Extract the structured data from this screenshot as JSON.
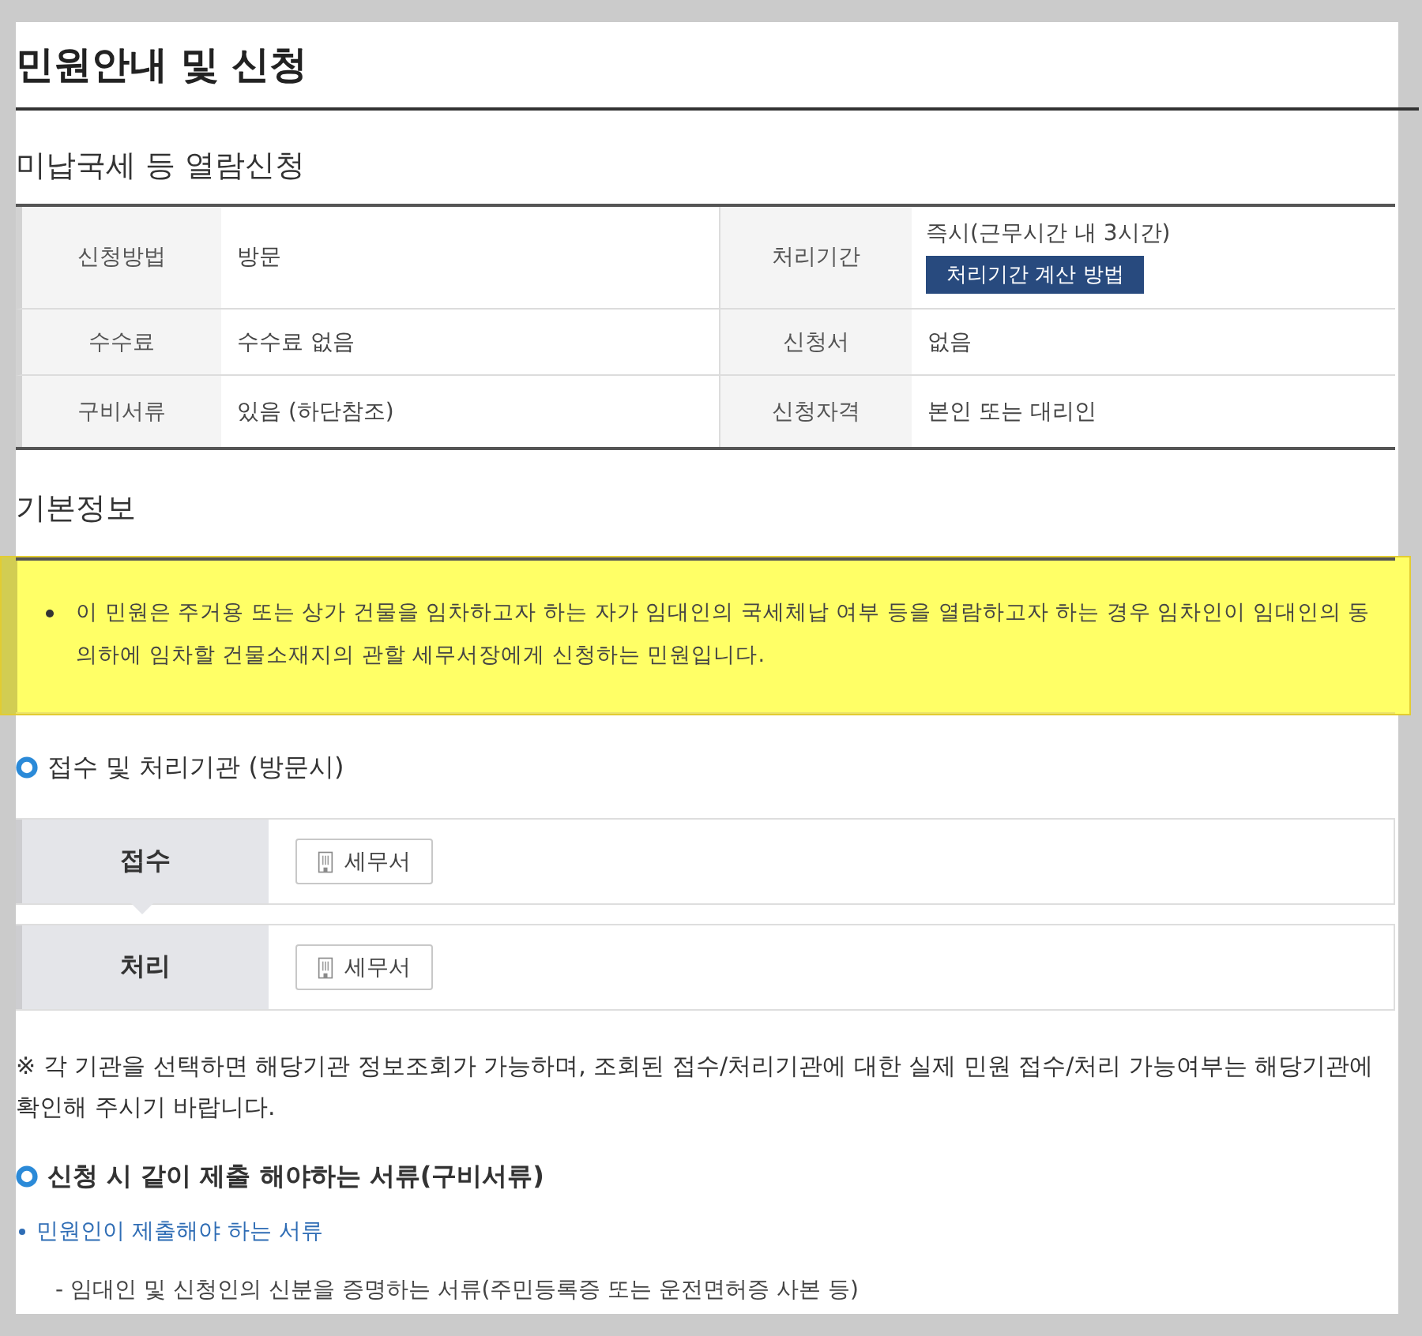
{
  "page": {
    "title": "민원안내 및 신청"
  },
  "service": {
    "title": "미납국세 등 열람신청",
    "rows": [
      [
        {
          "label": "신청방법",
          "value": "방문"
        },
        {
          "label": "처리기간",
          "value": "즉시(근무시간 내 3시간)",
          "button": "처리기간 계산 방법"
        }
      ],
      [
        {
          "label": "수수료",
          "value": "수수료 없음"
        },
        {
          "label": "신청서",
          "value": "없음"
        }
      ],
      [
        {
          "label": "구비서류",
          "value": "있음 (하단참조)"
        },
        {
          "label": "신청자격",
          "value": "본인 또는 대리인"
        }
      ]
    ]
  },
  "basic_info": {
    "title": "기본정보",
    "items": [
      "이 민원은 주거용 또는 상가 건물을 임차하고자 하는 자가 임대인의 국세체납 여부 등을 열람하고자 하는 경우 임차인이 임대인의 동의하에 임차할 건물소재지의 관할 세무서장에게 신청하는 민원입니다."
    ]
  },
  "agencies": {
    "title": "접수 및 처리기관 (방문시)",
    "steps": [
      {
        "label": "접수",
        "office": "세무서"
      },
      {
        "label": "처리",
        "office": "세무서"
      }
    ]
  },
  "note": "※ 각 기관을 선택하면 해당기관 정보조회가 가능하며, 조회된 접수/처리기관에 대한 실제 민원 접수/처리 가능여부는 해당기관에 확인해 주시기 바랍니다.",
  "documents": {
    "title": "신청 시 같이 제출 해야하는 서류(구비서류)",
    "groups": [
      {
        "title": "민원인이 제출해야 하는 서류",
        "items": [
          "- 임대인 및 신청인의 신분을 증명하는 서류(주민등록증 또는 운전면허증 사본 등)"
        ]
      }
    ]
  }
}
